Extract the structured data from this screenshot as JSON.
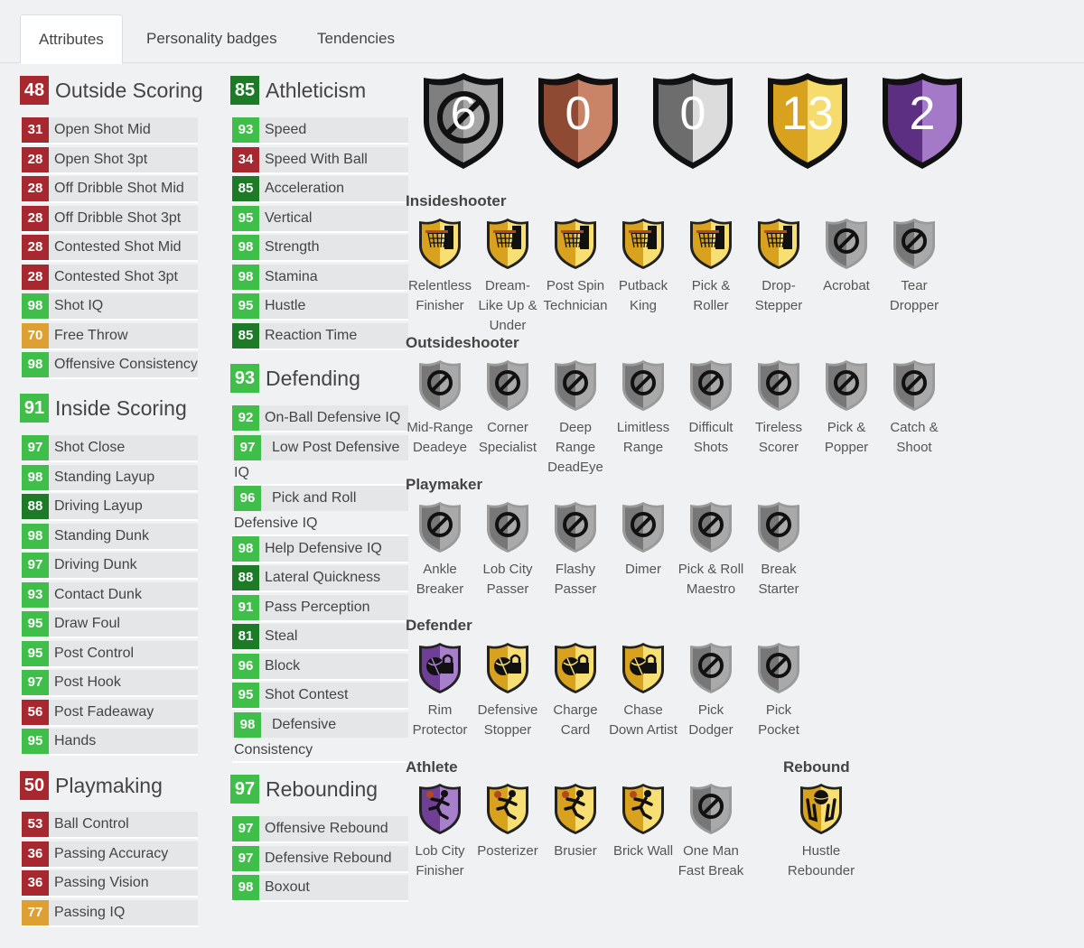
{
  "tabs": [
    "Attributes",
    "Personality badges",
    "Tendencies"
  ],
  "groups": {
    "outside": {
      "score": "48",
      "title": "Outside Scoring",
      "color": "#a8282f",
      "attrs": [
        {
          "v": "31",
          "n": "Open Shot Mid"
        },
        {
          "v": "28",
          "n": "Open Shot 3pt"
        },
        {
          "v": "28",
          "n": "Off Dribble Shot Mid"
        },
        {
          "v": "28",
          "n": "Off Dribble Shot 3pt"
        },
        {
          "v": "28",
          "n": "Contested Shot Mid"
        },
        {
          "v": "28",
          "n": "Contested Shot 3pt"
        },
        {
          "v": "98",
          "n": "Shot IQ"
        },
        {
          "v": "70",
          "n": "Free Throw"
        },
        {
          "v": "98",
          "n": "Offensive Consistency"
        }
      ]
    },
    "inside": {
      "score": "91",
      "title": "Inside Scoring",
      "color": "#3fbf49",
      "attrs": [
        {
          "v": "97",
          "n": "Shot Close"
        },
        {
          "v": "98",
          "n": "Standing Layup"
        },
        {
          "v": "88",
          "n": "Driving Layup"
        },
        {
          "v": "98",
          "n": "Standing Dunk"
        },
        {
          "v": "97",
          "n": "Driving Dunk"
        },
        {
          "v": "93",
          "n": "Contact Dunk"
        },
        {
          "v": "95",
          "n": "Draw Foul"
        },
        {
          "v": "95",
          "n": "Post Control"
        },
        {
          "v": "97",
          "n": "Post Hook"
        },
        {
          "v": "56",
          "n": "Post Fadeaway"
        },
        {
          "v": "95",
          "n": "Hands"
        }
      ]
    },
    "playmaking": {
      "score": "50",
      "title": "Playmaking",
      "color": "#a8282f",
      "attrs": [
        {
          "v": "53",
          "n": "Ball Control"
        },
        {
          "v": "36",
          "n": "Passing Accuracy"
        },
        {
          "v": "36",
          "n": "Passing Vision"
        },
        {
          "v": "77",
          "n": "Passing IQ"
        }
      ]
    },
    "athleticism": {
      "score": "85",
      "title": "Athleticism",
      "color": "#1d7a26",
      "attrs": [
        {
          "v": "93",
          "n": "Speed"
        },
        {
          "v": "34",
          "n": "Speed With Ball"
        },
        {
          "v": "85",
          "n": "Acceleration"
        },
        {
          "v": "95",
          "n": "Vertical"
        },
        {
          "v": "98",
          "n": "Strength"
        },
        {
          "v": "98",
          "n": "Stamina"
        },
        {
          "v": "95",
          "n": "Hustle"
        },
        {
          "v": "85",
          "n": "Reaction Time"
        }
      ]
    },
    "defending": {
      "score": "93",
      "title": "Defending",
      "color": "#3fbf49",
      "attrs": [
        {
          "v": "92",
          "n": "On-Ball Defensive IQ"
        },
        {
          "v": "97",
          "n": "Low Post Defensive",
          "n2": "IQ"
        },
        {
          "v": "96",
          "n": "Pick and Roll",
          "n2": "Defensive IQ"
        },
        {
          "v": "98",
          "n": "Help Defensive IQ"
        },
        {
          "v": "88",
          "n": "Lateral Quickness"
        },
        {
          "v": "91",
          "n": "Pass Perception"
        },
        {
          "v": "81",
          "n": "Steal"
        },
        {
          "v": "96",
          "n": "Block"
        },
        {
          "v": "95",
          "n": "Shot Contest"
        },
        {
          "v": "98",
          "n": "Defensive",
          "n2": "Consistency"
        }
      ]
    },
    "rebounding": {
      "score": "97",
      "title": "Rebounding",
      "color": "#3fbf49",
      "attrs": [
        {
          "v": "97",
          "n": "Offensive Rebound"
        },
        {
          "v": "97",
          "n": "Defensive Rebound"
        },
        {
          "v": "98",
          "n": "Boxout"
        }
      ]
    }
  },
  "shields": [
    {
      "count": "6",
      "tier": "none"
    },
    {
      "count": "0",
      "tier": "bronze"
    },
    {
      "count": "0",
      "tier": "silver"
    },
    {
      "count": "13",
      "tier": "gold"
    },
    {
      "count": "2",
      "tier": "hof"
    }
  ],
  "badge_categories": [
    {
      "title": "Insideshooter",
      "badges": [
        {
          "name": "Relentless Finisher",
          "tier": "gold",
          "icon": "hoop"
        },
        {
          "name": "Dream-Like Up & Under",
          "tier": "gold",
          "icon": "hoop"
        },
        {
          "name": "Post Spin Technician",
          "tier": "gold",
          "icon": "hoop"
        },
        {
          "name": "Putback King",
          "tier": "gold",
          "icon": "hoop"
        },
        {
          "name": "Pick & Roller",
          "tier": "gold",
          "icon": "hoop"
        },
        {
          "name": "Drop-Stepper",
          "tier": "gold",
          "icon": "hoop"
        },
        {
          "name": "Acrobat",
          "tier": "none",
          "icon": "none"
        },
        {
          "name": "Tear Dropper",
          "tier": "none",
          "icon": "none"
        }
      ]
    },
    {
      "title": "Outsideshooter",
      "badges": [
        {
          "name": "Mid-Range Deadeye",
          "tier": "none",
          "icon": "none"
        },
        {
          "name": "Corner Specialist",
          "tier": "none",
          "icon": "none"
        },
        {
          "name": "Deep Range DeadEye",
          "tier": "none",
          "icon": "none"
        },
        {
          "name": "Limitless Range",
          "tier": "none",
          "icon": "none"
        },
        {
          "name": "Difficult Shots",
          "tier": "none",
          "icon": "none"
        },
        {
          "name": "Tireless Scorer",
          "tier": "none",
          "icon": "none"
        },
        {
          "name": "Pick & Popper",
          "tier": "none",
          "icon": "none"
        },
        {
          "name": "Catch & Shoot",
          "tier": "none",
          "icon": "none"
        }
      ]
    },
    {
      "title": "Playmaker",
      "badges": [
        {
          "name": "Ankle Breaker",
          "tier": "none",
          "icon": "none"
        },
        {
          "name": "Lob City Passer",
          "tier": "none",
          "icon": "none"
        },
        {
          "name": "Flashy Passer",
          "tier": "none",
          "icon": "none"
        },
        {
          "name": "Dimer",
          "tier": "none",
          "icon": "none"
        },
        {
          "name": "Pick & Roll Maestro",
          "tier": "none",
          "icon": "none"
        },
        {
          "name": "Break Starter",
          "tier": "none",
          "icon": "none"
        }
      ]
    },
    {
      "title": "Defender",
      "badges": [
        {
          "name": "Rim Protector",
          "tier": "hof",
          "icon": "lock"
        },
        {
          "name": "Defensive Stopper",
          "tier": "gold",
          "icon": "lock"
        },
        {
          "name": "Charge Card",
          "tier": "gold",
          "icon": "lock"
        },
        {
          "name": "Chase Down Artist",
          "tier": "gold",
          "icon": "lock"
        },
        {
          "name": "Pick Dodger",
          "tier": "none",
          "icon": "none"
        },
        {
          "name": "Pick Pocket",
          "tier": "none",
          "icon": "none"
        }
      ]
    },
    {
      "title": "Athlete",
      "badges": [
        {
          "name": "Lob City Finisher",
          "tier": "hof",
          "icon": "runner"
        },
        {
          "name": "Posterizer",
          "tier": "gold",
          "icon": "runner"
        },
        {
          "name": "Brusier",
          "tier": "gold",
          "icon": "runner"
        },
        {
          "name": "Brick Wall",
          "tier": "gold",
          "icon": "runner"
        },
        {
          "name": "One Man Fast Break",
          "tier": "none",
          "icon": "none"
        }
      ]
    },
    {
      "title": "Rebound",
      "badges": [
        {
          "name": "Hustle Rebounder",
          "tier": "gold",
          "icon": "hands"
        }
      ]
    }
  ],
  "colors": {
    "red": "#a8282f",
    "green": "#3fbf49",
    "dark_green": "#1d7a26",
    "orange": "#dfa033",
    "gold": "#f0c33c",
    "hof": "#8e5fb5",
    "none": "#8f8f8f"
  }
}
